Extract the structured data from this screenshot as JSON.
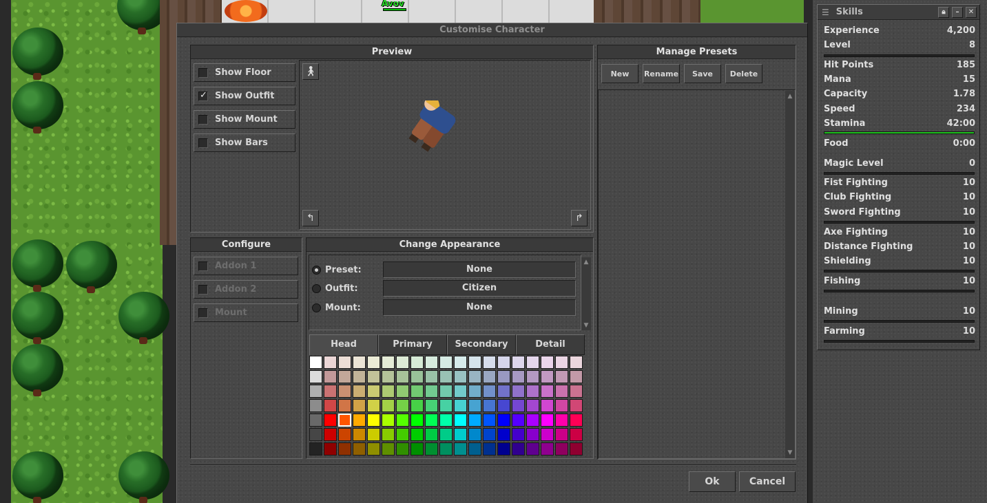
{
  "world": {
    "player_name": "Avov"
  },
  "dialog": {
    "title": "Customise Character",
    "preview": {
      "header": "Preview",
      "options": [
        {
          "label": "Show Floor",
          "checked": false
        },
        {
          "label": "Show Outfit",
          "checked": true
        },
        {
          "label": "Show Mount",
          "checked": false
        },
        {
          "label": "Show Bars",
          "checked": false
        }
      ]
    },
    "presets": {
      "header": "Manage Presets",
      "new_label": "New",
      "rename_label": "Rename",
      "save_label": "Save",
      "delete_label": "Delete"
    },
    "configure": {
      "header": "Configure",
      "addon1": "Addon 1",
      "addon2": "Addon 2",
      "mount": "Mount"
    },
    "appearance": {
      "header": "Change Appearance",
      "preset_label": "Preset:",
      "preset_value": "None",
      "outfit_label": "Outfit:",
      "outfit_value": "Citizen",
      "mount_label": "Mount:",
      "mount_value": "None",
      "tabs": [
        "Head",
        "Primary",
        "Secondary",
        "Detail"
      ],
      "active_tab": "Head",
      "selected_color": {
        "row": 4,
        "col": 2
      }
    },
    "ok_label": "Ok",
    "cancel_label": "Cancel"
  },
  "skills": {
    "title": "Skills",
    "rows": [
      {
        "name": "Experience",
        "value": "4,200"
      },
      {
        "name": "Level",
        "value": "8"
      },
      {
        "name": "Hit Points",
        "value": "185"
      },
      {
        "name": "Mana",
        "value": "15"
      },
      {
        "name": "Capacity",
        "value": "1.78"
      },
      {
        "name": "Speed",
        "value": "234"
      },
      {
        "name": "Stamina",
        "value": "42:00"
      },
      {
        "name": "Food",
        "value": "0:00"
      },
      {
        "name": "Magic Level",
        "value": "0"
      },
      {
        "name": "Fist Fighting",
        "value": "10"
      },
      {
        "name": "Club Fighting",
        "value": "10"
      },
      {
        "name": "Sword Fighting",
        "value": "10"
      },
      {
        "name": "Axe Fighting",
        "value": "10"
      },
      {
        "name": "Distance Fighting",
        "value": "10"
      },
      {
        "name": "Shielding",
        "value": "10"
      },
      {
        "name": "Fishing",
        "value": "10"
      },
      {
        "name": "Mining",
        "value": "10"
      },
      {
        "name": "Farming",
        "value": "10"
      }
    ],
    "stamina_fill": 1.0,
    "stamina_color": "#1ec21e"
  }
}
